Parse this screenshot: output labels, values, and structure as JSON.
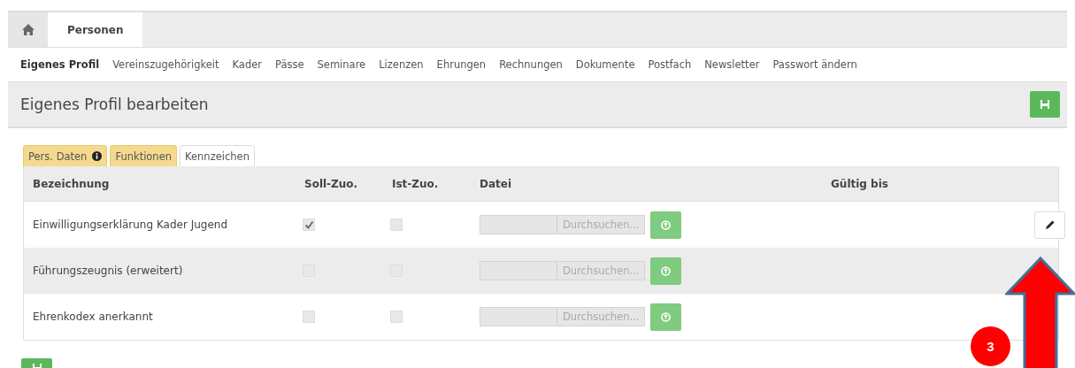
{
  "top_tabs": [
    {
      "kind": "home",
      "selected": false
    },
    {
      "kind": "text",
      "label": "Personen",
      "selected": true
    }
  ],
  "subnav": [
    {
      "label": "Eigenes Profil",
      "selected": true
    },
    {
      "label": "Vereinszugehörigkeit",
      "selected": false
    },
    {
      "label": "Kader",
      "selected": false
    },
    {
      "label": "Pässe",
      "selected": false
    },
    {
      "label": "Seminare",
      "selected": false
    },
    {
      "label": "Lizenzen",
      "selected": false
    },
    {
      "label": "Ehrungen",
      "selected": false
    },
    {
      "label": "Rechnungen",
      "selected": false
    },
    {
      "label": "Dokumente",
      "selected": false
    },
    {
      "label": "Postfach",
      "selected": false
    },
    {
      "label": "Newsletter",
      "selected": false
    },
    {
      "label": "Passwort ändern",
      "selected": false
    }
  ],
  "page_title": "Eigenes Profil bearbeiten",
  "tabs": [
    {
      "label": "Pers. Daten",
      "info": true,
      "selected": false
    },
    {
      "label": "Funktionen",
      "info": false,
      "selected": false
    },
    {
      "label": "Kennzeichen",
      "info": false,
      "selected": true
    }
  ],
  "table": {
    "columns": [
      "Bezeichnung",
      "Soll-Zuo.",
      "Ist-Zuo.",
      "Datei",
      "Gültig bis"
    ],
    "rows": [
      {
        "name": "Einwilligungserklärung Kader Jugend",
        "soll_checked": true,
        "ist_checked": false,
        "file_button": "Durchsuchen...",
        "edit": true
      },
      {
        "name": "Führungszeugnis (erweitert)",
        "soll_checked": false,
        "ist_checked": false,
        "file_button": "Durchsuchen...",
        "edit": false
      },
      {
        "name": "Ehrenkodex anerkannt",
        "soll_checked": false,
        "ist_checked": false,
        "file_button": "Durchsuchen...",
        "edit": false
      }
    ]
  },
  "annotation": {
    "badge": "3"
  }
}
